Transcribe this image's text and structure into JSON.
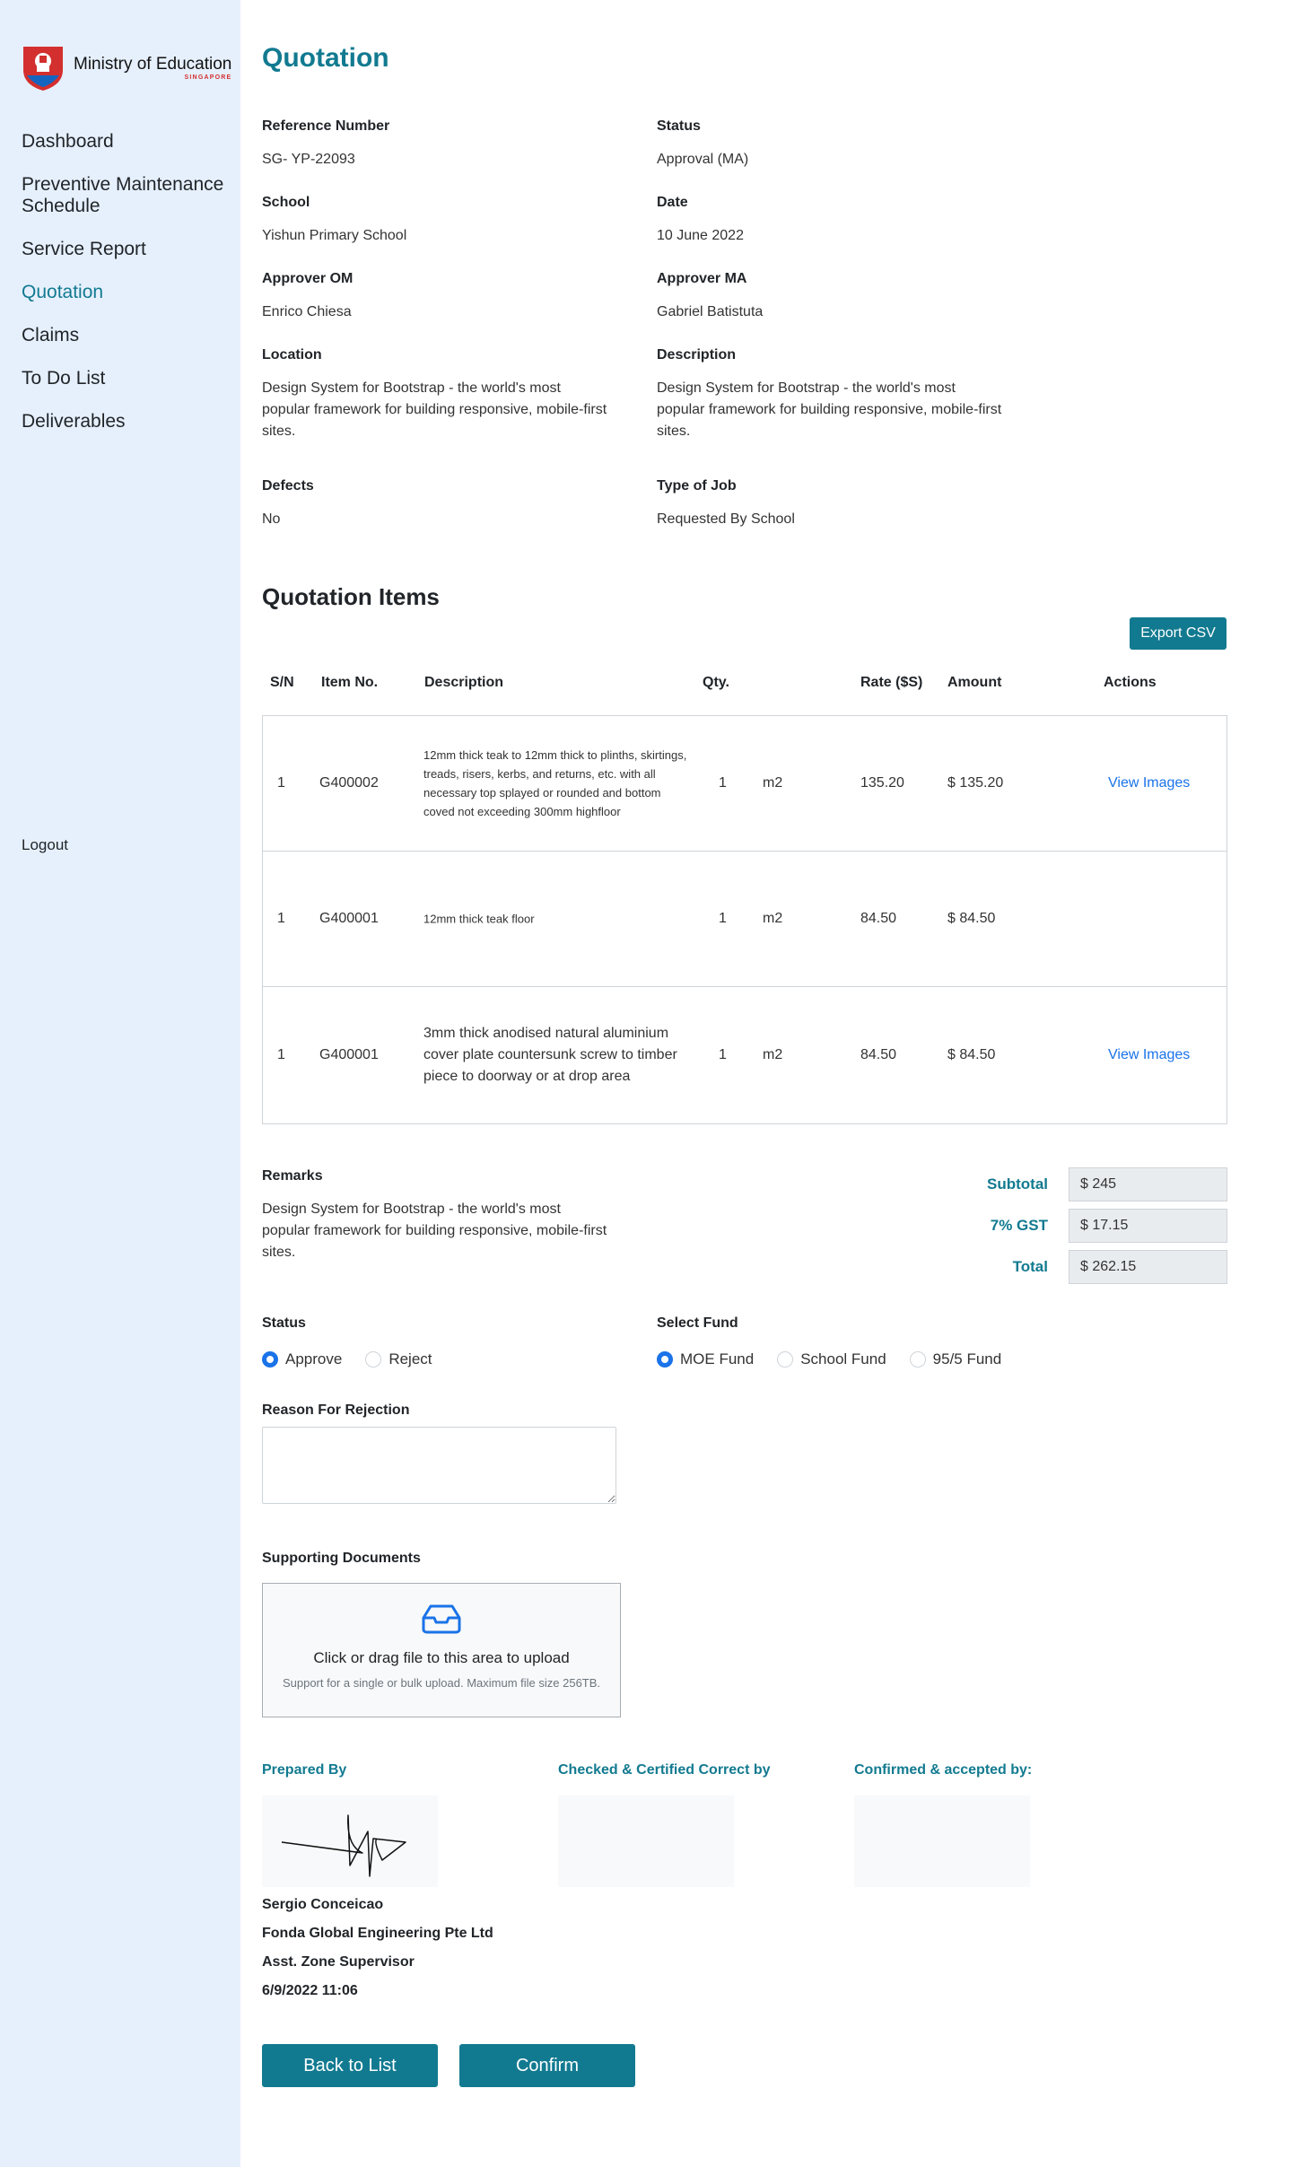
{
  "logo": {
    "name": "Ministry of Education",
    "sub": "SINGAPORE"
  },
  "nav": {
    "items": [
      "Dashboard",
      "Preventive Maintenance Schedule",
      "Service Report",
      "Quotation",
      "Claims",
      "To Do List",
      "Deliverables"
    ],
    "active": "Quotation",
    "logout": "Logout"
  },
  "page": {
    "title": "Quotation"
  },
  "details": {
    "reference_label": "Reference Number",
    "reference_value": "SG- YP-22093",
    "status_label": "Status",
    "status_value": "Approval (MA)",
    "school_label": "School",
    "school_value": "Yishun Primary School",
    "date_label": "Date",
    "date_value": "10 June 2022",
    "approver_om_label": "Approver OM",
    "approver_om_value": "Enrico Chiesa",
    "approver_ma_label": "Approver MA",
    "approver_ma_value": "Gabriel Batistuta",
    "location_label": "Location",
    "location_value": "Design System for Bootstrap - the world's most popular framework for building responsive, mobile-first sites.",
    "description_label": "Description",
    "description_value": "Design System for Bootstrap - the world's most popular framework for building responsive, mobile-first sites.",
    "defects_label": "Defects",
    "defects_value": "No",
    "job_type_label": "Type of Job",
    "job_type_value": "Requested By School"
  },
  "items_section": {
    "title": "Quotation Items",
    "export_label": "Export CSV",
    "headers": [
      "S/N",
      "Item No.",
      "Description",
      "Qty.",
      "Rate ($S)",
      "Amount",
      "Actions"
    ],
    "rows": [
      {
        "sn": "1",
        "item_no": "G400002",
        "description": "12mm thick teak to 12mm thick to plinths, skirtings, treads, risers, kerbs, and returns, etc. with all necessary top splayed or rounded and bottom coved not exceeding 300mm highfloor",
        "qty": "1",
        "unit": "m2",
        "rate": "135.20",
        "amount": "$ 135.20",
        "action": "View Images"
      },
      {
        "sn": "1",
        "item_no": "G400001",
        "description": "12mm thick teak floor",
        "qty": "1",
        "unit": "m2",
        "rate": "84.50",
        "amount": "$ 84.50",
        "action": ""
      },
      {
        "sn": "1",
        "item_no": "G400001",
        "description": "3mm thick anodised natural aluminium cover plate countersunk screw to timber piece to doorway or at drop area",
        "qty": "1",
        "unit": "m2",
        "rate": "84.50",
        "amount": "$ 84.50",
        "action": "View Images"
      }
    ]
  },
  "remarks": {
    "label": "Remarks",
    "value": "Design System for Bootstrap - the world's most popular framework for building responsive, mobile-first sites."
  },
  "totals": {
    "subtotal_label": "Subtotal",
    "subtotal_value": "$ 245",
    "gst_label": "7% GST",
    "gst_value": "$ 17.15",
    "total_label": "Total",
    "total_value": "$ 262.15"
  },
  "status_select": {
    "label": "Status",
    "options": [
      "Approve",
      "Reject"
    ],
    "selected": "Approve"
  },
  "fund_select": {
    "label": "Select Fund",
    "options": [
      "MOE Fund",
      "School Fund",
      "95/5 Fund"
    ],
    "selected": "MOE Fund"
  },
  "rejection": {
    "label": "Reason For Rejection",
    "value": ""
  },
  "documents": {
    "label": "Supporting Documents",
    "upload_text": "Click or drag file to this area to upload",
    "upload_hint": "Support for a single or bulk upload. Maximum file size 256TB."
  },
  "signatures": {
    "prepared_label": "Prepared By",
    "checked_label": "Checked & Certified Correct by",
    "confirmed_label": "Confirmed & accepted by:",
    "preparer_name": "Sergio Conceicao",
    "preparer_company": "Fonda Global Engineering Pte Ltd",
    "preparer_title": "Asst. Zone Supervisor",
    "preparer_datetime": "6/9/2022 11:06"
  },
  "actions": {
    "back_label": "Back to List",
    "confirm_label": "Confirm"
  },
  "colors": {
    "accent": "#127a90",
    "sidebar_bg": "#e6f0fd",
    "link": "#1a73e8"
  }
}
